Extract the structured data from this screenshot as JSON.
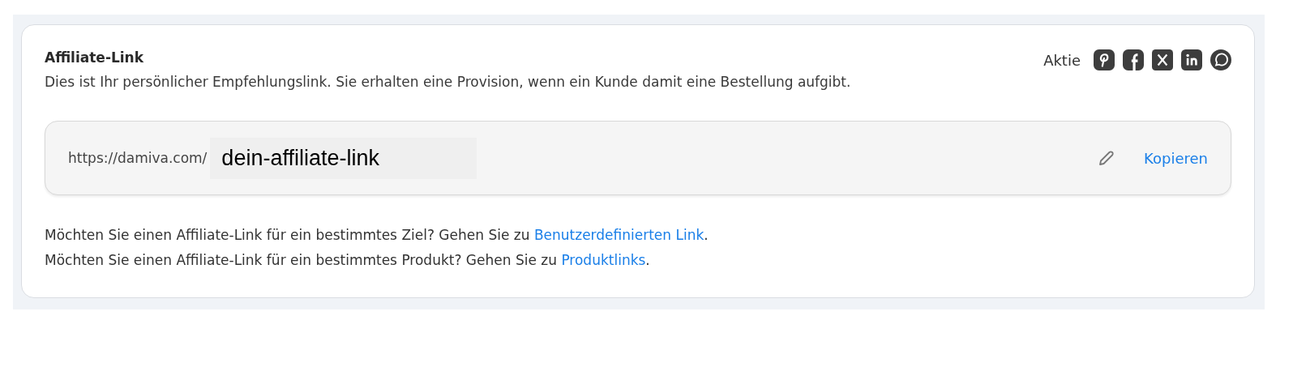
{
  "card": {
    "title": "Affiliate-Link",
    "description": "Dies ist Ihr persönlicher Empfehlungslink. Sie erhalten eine Provision, wenn ein Kunde damit eine Bestellung aufgibt.",
    "share": {
      "label": "Aktie",
      "networks": [
        {
          "kind": "pinterest"
        },
        {
          "kind": "facebook"
        },
        {
          "kind": "x"
        },
        {
          "kind": "linkedin"
        },
        {
          "kind": "whatsapp"
        }
      ]
    },
    "link_field": {
      "prefix": "https://damiva.com/",
      "value": "dein-affiliate-link",
      "copy_label": "Kopieren"
    },
    "notes": [
      {
        "text": "Möchten Sie einen Affiliate-Link für ein bestimmtes Ziel? Gehen Sie zu ",
        "link": "Benutzerdefinierten Link",
        "after": "."
      },
      {
        "text": "Möchten Sie einen Affiliate-Link für ein bestimmtes Produkt? Gehen Sie zu ",
        "link": "Produktlinks",
        "after": "."
      }
    ]
  }
}
